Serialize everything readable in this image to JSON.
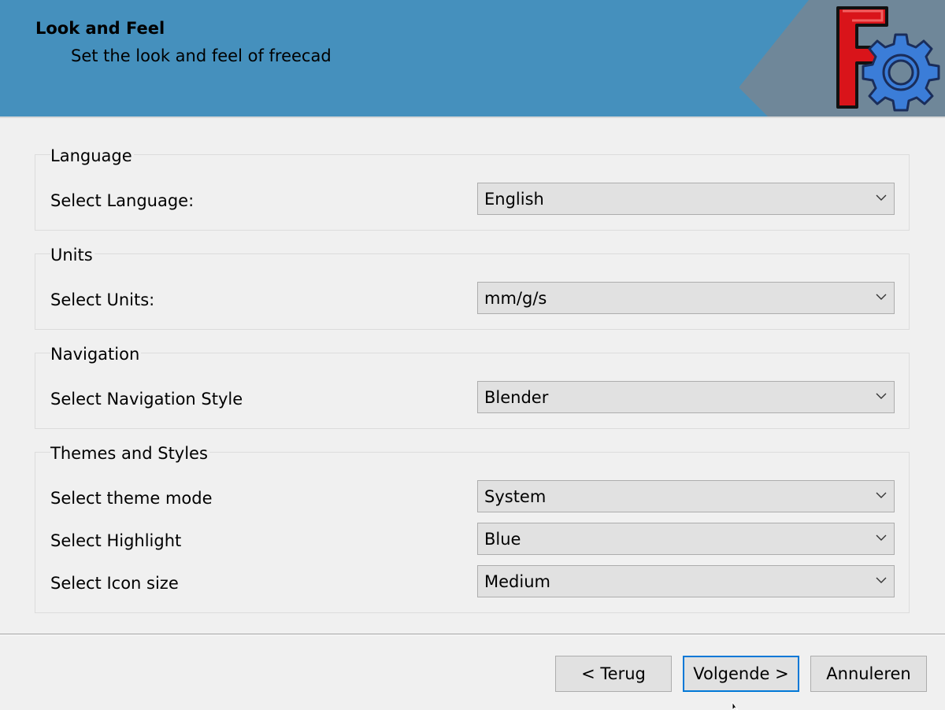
{
  "header": {
    "title": "Look and Feel",
    "subtitle": "Set the look and feel of freecad",
    "banner_color": "#4590bd",
    "logo_icon": "freecad-logo-icon"
  },
  "groups": {
    "language": {
      "title": "Language",
      "rows": [
        {
          "label": "Select Language:",
          "value": "English"
        }
      ]
    },
    "units": {
      "title": "Units",
      "rows": [
        {
          "label": "Select Units:",
          "value": "mm/g/s"
        }
      ]
    },
    "navigation": {
      "title": "Navigation",
      "rows": [
        {
          "label": "Select Navigation Style",
          "value": "Blender"
        }
      ]
    },
    "themes": {
      "title": "Themes and Styles",
      "rows": [
        {
          "label": "Select theme mode",
          "value": "System"
        },
        {
          "label": "Select Highlight",
          "value": "Blue"
        },
        {
          "label": "Select Icon size",
          "value": "Medium"
        }
      ]
    }
  },
  "footer": {
    "back_label": "< Terug",
    "next_label": "Volgende >",
    "cancel_label": "Annuleren",
    "focus_color": "#0078d7"
  }
}
